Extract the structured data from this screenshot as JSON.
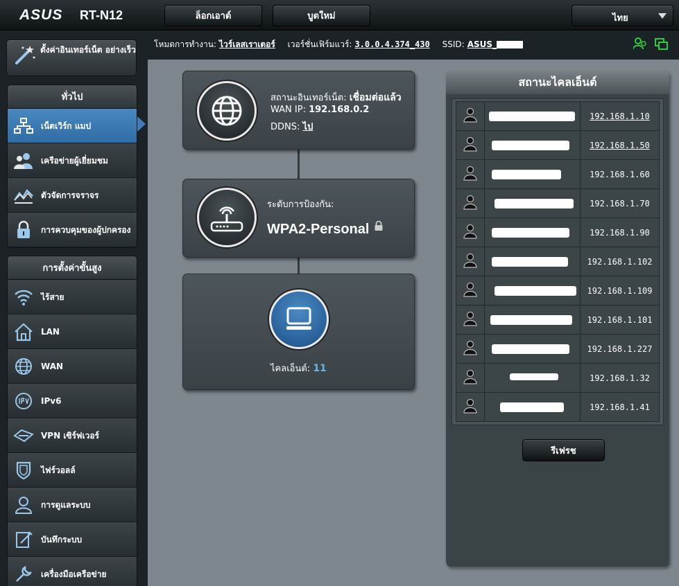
{
  "header": {
    "brand": "ASUS",
    "model": "RT-N12",
    "logout_label": "ล็อกเอาต์",
    "reboot_label": "บูตใหม่",
    "language": "ไทย"
  },
  "statusline": {
    "mode_label": "โหมดการทำงาน:",
    "mode_value": "ไวร์เลสเราเตอร์",
    "firmware_label": "เวอร์ชั่นเฟิร์มแวร์:",
    "firmware_value": "3.0.0.4.374_430",
    "ssid_label": "SSID:",
    "ssid_value": "ASUS_"
  },
  "sidebar": {
    "quick_setup": "ตั้งค่าอินเทอร์เน็ต อย่างเร็ว",
    "general_title": "ทั่วไป",
    "general_items": [
      {
        "label": "เน็ตเวิร์ก แมป",
        "icon": "network-map-icon"
      },
      {
        "label": "เครือข่ายผู้เยี่ยมชม",
        "icon": "guest-network-icon"
      },
      {
        "label": "ตัวจัดการจราจร",
        "icon": "traffic-manager-icon"
      },
      {
        "label": "การควบคุมของผู้ปกครอง",
        "icon": "parental-control-icon"
      }
    ],
    "advanced_title": "การตั้งค่าขั้นสูง",
    "advanced_items": [
      {
        "label": "ไร้สาย",
        "icon": "wireless-icon"
      },
      {
        "label": "LAN",
        "icon": "home-icon"
      },
      {
        "label": "WAN",
        "icon": "globe-icon"
      },
      {
        "label": "IPv6",
        "icon": "ipv6-icon"
      },
      {
        "label": "VPN เซิร์ฟเวอร์",
        "icon": "vpn-icon"
      },
      {
        "label": "ไฟร์วอลล์",
        "icon": "firewall-icon"
      },
      {
        "label": "การดูแลระบบ",
        "icon": "admin-icon"
      },
      {
        "label": "บันทึกระบบ",
        "icon": "log-icon"
      },
      {
        "label": "เครื่องมือเครือข่าย",
        "icon": "tools-icon"
      }
    ]
  },
  "internet": {
    "status_label": "สถานะอินเทอร์เน็ต:",
    "status_value": "เชื่อมต่อแล้ว",
    "wan_ip_label": "WAN IP:",
    "wan_ip_value": "192.168.0.2",
    "ddns_label": "DDNS:",
    "ddns_value": "ไป"
  },
  "security": {
    "label": "ระดับการป้องกัน:",
    "value": "WPA2-Personal"
  },
  "clients": {
    "label": "ไคลเอ็นต์:",
    "count": "11"
  },
  "client_panel": {
    "title": "สถานะไคลเอ็นต์",
    "rows": [
      {
        "ip": "192.168.1.10",
        "link": true
      },
      {
        "ip": "192.168.1.50",
        "link": true
      },
      {
        "ip": "192.168.1.60",
        "link": false
      },
      {
        "ip": "192.168.1.70",
        "link": false
      },
      {
        "ip": "192.168.1.90",
        "link": false
      },
      {
        "ip": "192.168.1.102",
        "link": false
      },
      {
        "ip": "192.168.1.109",
        "link": false
      },
      {
        "ip": "192.168.1.101",
        "link": false
      },
      {
        "ip": "192.168.1.227",
        "link": false
      },
      {
        "ip": "192.168.1.32",
        "link": false
      },
      {
        "ip": "192.168.1.41",
        "link": false
      }
    ],
    "refresh_label": "รีเฟรช"
  }
}
